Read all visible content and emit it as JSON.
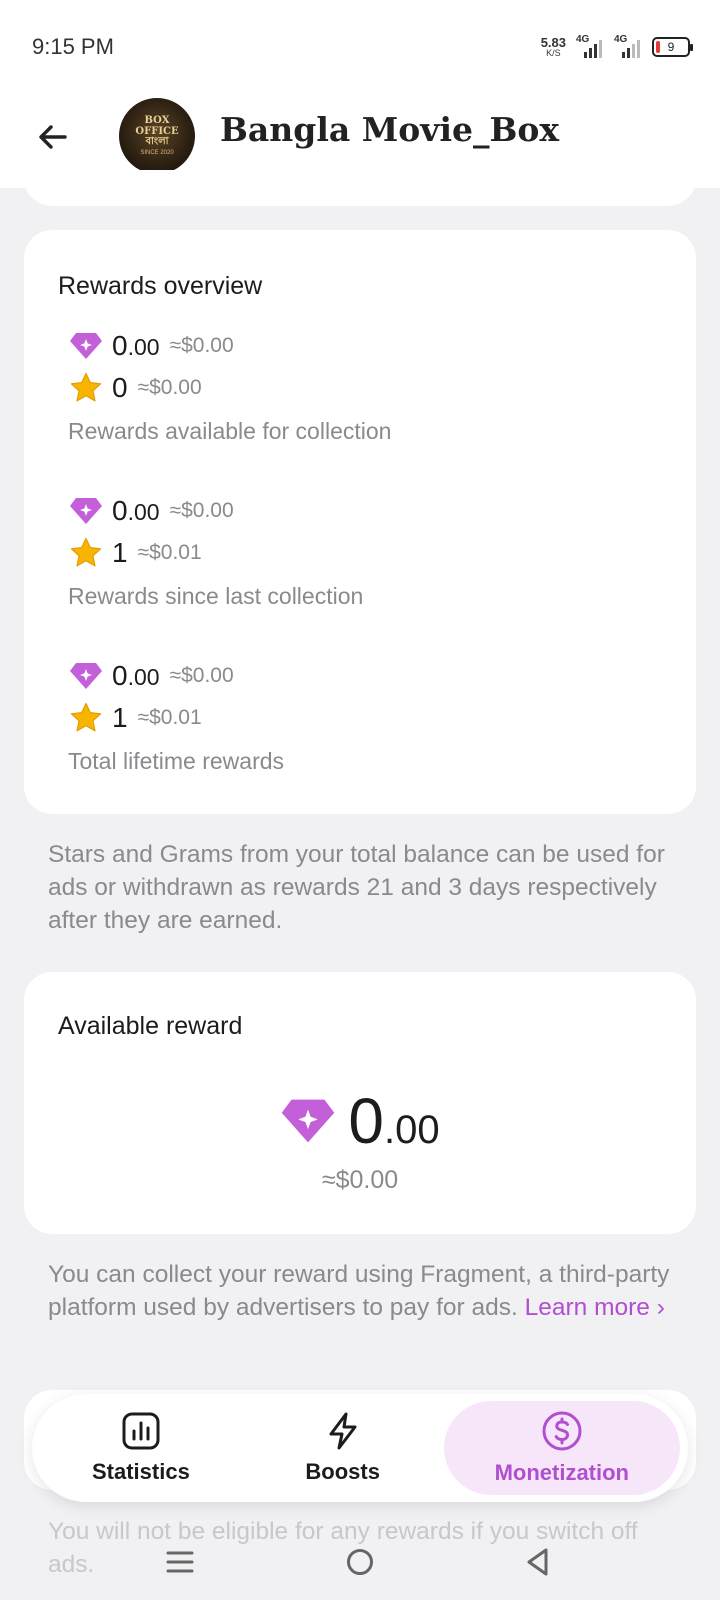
{
  "status_bar": {
    "time": "9:15 PM",
    "net_speed_value": "5.83",
    "net_speed_unit": "K/S",
    "sim1": "4G",
    "sim2": "4G",
    "battery_level": "9"
  },
  "header": {
    "channel_name": "Bangla Movie_Box",
    "avatar_text": [
      "BOX",
      "OFFICE",
      "বাংলা",
      "SINCE 2020"
    ]
  },
  "rewards_overview": {
    "title": "Rewards overview",
    "groups": [
      {
        "grams": {
          "int": "0",
          "dec": ".00",
          "approx": "≈$0.00"
        },
        "stars": {
          "amount": "0",
          "approx": "≈$0.00"
        },
        "description": "Rewards available for collection"
      },
      {
        "grams": {
          "int": "0",
          "dec": ".00",
          "approx": "≈$0.00"
        },
        "stars": {
          "amount": "1",
          "approx": "≈$0.01"
        },
        "description": "Rewards since last collection"
      },
      {
        "grams": {
          "int": "0",
          "dec": ".00",
          "approx": "≈$0.00"
        },
        "stars": {
          "amount": "1",
          "approx": "≈$0.01"
        },
        "description": "Total lifetime rewards"
      }
    ]
  },
  "balance_note": "Stars and Grams from your total balance can be used for ads or withdrawn as rewards 21 and 3 days respectively after they are earned.",
  "available_reward": {
    "title": "Available reward",
    "int": "0",
    "dec": ".00",
    "approx": "≈$0.00"
  },
  "fragment_note": {
    "text": "You can collect your reward using Fragment, a third-party platform used by advertisers to pay for ads.",
    "link": "Learn more ›"
  },
  "tabs": [
    {
      "label": "Statistics",
      "icon": "bar-chart-icon",
      "active": false
    },
    {
      "label": "Boosts",
      "icon": "lightning-icon",
      "active": false
    },
    {
      "label": "Monetization",
      "icon": "dollar-circle-icon",
      "active": true
    }
  ],
  "bottom_note": "You will not be eligible for any rewards if you switch off ads.",
  "colors": {
    "accent": "#b04fd0",
    "gem": "#c35fd9",
    "star": "#f7b500",
    "background": "#f1f1f4"
  }
}
